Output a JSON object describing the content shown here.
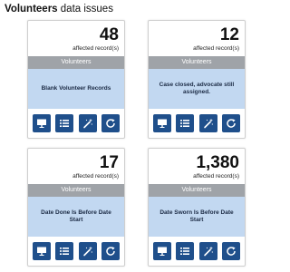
{
  "header": {
    "title_bold": "Volunteers",
    "title_rest": " data issues"
  },
  "cards": [
    {
      "count": "48",
      "affected_label": "affected record(s)",
      "category": "Volunteers",
      "issue": "Blank Volunteer Records"
    },
    {
      "count": "12",
      "affected_label": "affected record(s)",
      "category": "Volunteers",
      "issue": "Case closed, advocate still assigned."
    },
    {
      "count": "17",
      "affected_label": "affected record(s)",
      "category": "Volunteers",
      "issue": "Date Done Is Before Date Start"
    },
    {
      "count": "1,380",
      "affected_label": "affected record(s)",
      "category": "Volunteers",
      "issue": "Date Sworn Is Before Date Start"
    }
  ],
  "colors": {
    "action_button": "#1f4f8b",
    "category_band": "#9fa3a8",
    "issue_area": "#c2d8f1"
  },
  "action_icons": [
    "presentation-icon",
    "list-icon",
    "magic-wand-icon",
    "refresh-icon"
  ]
}
